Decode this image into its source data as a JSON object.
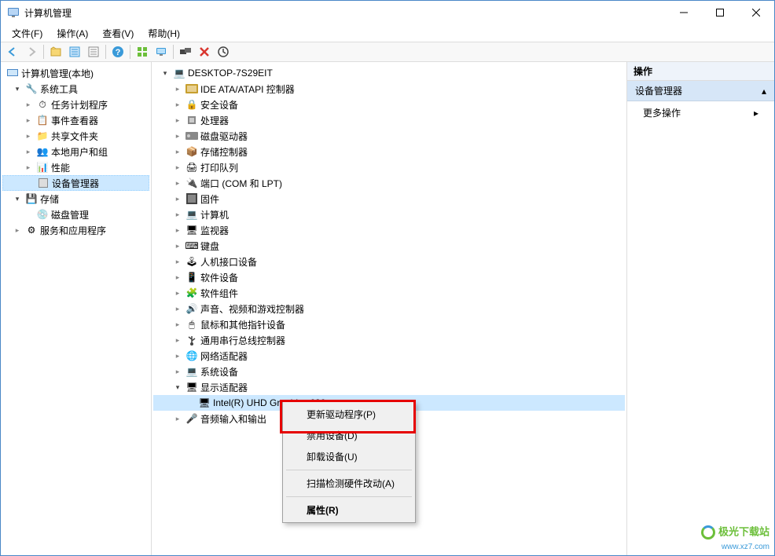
{
  "window": {
    "title": "计算机管理"
  },
  "menu": {
    "file": "文件(F)",
    "action": "操作(A)",
    "view": "查看(V)",
    "help": "帮助(H)"
  },
  "left_tree": {
    "root": "计算机管理(本地)",
    "system_tools": "系统工具",
    "task_scheduler": "任务计划程序",
    "event_viewer": "事件查看器",
    "shared_folders": "共享文件夹",
    "local_users": "本地用户和组",
    "performance": "性能",
    "device_manager": "设备管理器",
    "storage": "存储",
    "disk_management": "磁盘管理",
    "services_apps": "服务和应用程序"
  },
  "device_tree": {
    "computer": "DESKTOP-7S29EIT",
    "ide": "IDE ATA/ATAPI 控制器",
    "security": "安全设备",
    "processors": "处理器",
    "disk_drives": "磁盘驱动器",
    "storage_ctrl": "存储控制器",
    "print_queues": "打印队列",
    "ports": "端口 (COM 和 LPT)",
    "firmware": "固件",
    "computers": "计算机",
    "monitors": "监视器",
    "keyboards": "键盘",
    "hid": "人机接口设备",
    "software_devices": "软件设备",
    "software_components": "软件组件",
    "sound": "声音、视频和游戏控制器",
    "mice": "鼠标和其他指针设备",
    "usb": "通用串行总线控制器",
    "network": "网络适配器",
    "system_devices": "系统设备",
    "display_adapters": "显示适配器",
    "gpu": "Intel(R) UHD Graphics 630",
    "audio_io": "音频输入和输出"
  },
  "context_menu": {
    "update_driver": "更新驱动程序(P)",
    "disable_device": "禁用设备(D)",
    "uninstall_device": "卸载设备(U)",
    "scan_hardware": "扫描检测硬件改动(A)",
    "properties": "属性(R)"
  },
  "actions_pane": {
    "header": "操作",
    "section": "设备管理器",
    "more_actions": "更多操作"
  },
  "watermark": {
    "title": "极光下载站",
    "url": "www.xz7.com"
  }
}
